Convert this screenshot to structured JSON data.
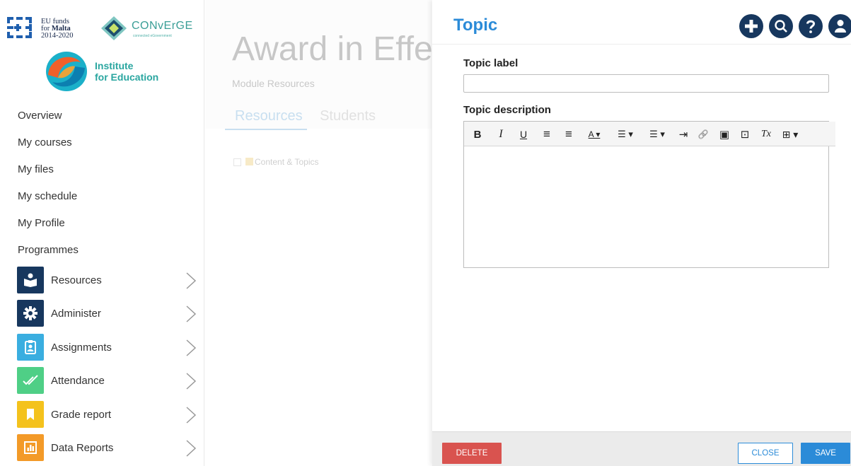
{
  "logos": {
    "eu_funds": {
      "line1": "EU funds",
      "line2_prefix": "for ",
      "line2_bold": "Malta",
      "line3": "2014-2020"
    },
    "converge": {
      "name": "CONvErGE",
      "tagline": "connected eGovernment"
    },
    "institute": {
      "line1": "Institute",
      "line2": "for Education"
    }
  },
  "sidebar": {
    "nav": [
      {
        "label": "Overview"
      },
      {
        "label": "My courses"
      },
      {
        "label": "My files"
      },
      {
        "label": "My schedule"
      },
      {
        "label": "My Profile"
      },
      {
        "label": "Programmes"
      }
    ],
    "menu": [
      {
        "label": "Resources",
        "icon": "resources-icon",
        "color": "#17375e"
      },
      {
        "label": "Administer",
        "icon": "gear-icon",
        "color": "#17375e"
      },
      {
        "label": "Assignments",
        "icon": "clipboard-icon",
        "color": "#3aaee0"
      },
      {
        "label": "Attendance",
        "icon": "checkmark-icon",
        "color": "#4fcf86"
      },
      {
        "label": "Grade report",
        "icon": "bookmark-icon",
        "color": "#f4c21d"
      },
      {
        "label": "Data Reports",
        "icon": "chart-icon",
        "color": "#f39a28"
      }
    ]
  },
  "main": {
    "title": "Award in Effec",
    "subtitle": "Module Resources",
    "tabs": [
      {
        "label": "Resources",
        "active": true
      },
      {
        "label": "Students",
        "active": false
      }
    ],
    "folder_label": "Content & Topics"
  },
  "panel": {
    "title": "Topic",
    "top_icons": [
      "add-icon",
      "search-icon",
      "help-icon",
      "user-icon"
    ],
    "label_field": {
      "label": "Topic label",
      "value": ""
    },
    "description_field": {
      "label": "Topic description",
      "value": ""
    },
    "toolbar": [
      {
        "name": "bold",
        "glyph": "B"
      },
      {
        "name": "italic",
        "glyph": "I"
      },
      {
        "name": "underline",
        "glyph": "U"
      },
      {
        "name": "align-left",
        "glyph": "≡"
      },
      {
        "name": "align-center",
        "glyph": "≡"
      },
      {
        "name": "text-color",
        "glyph": "A ▾"
      },
      {
        "name": "bullet-list",
        "glyph": "☰ ▾"
      },
      {
        "name": "numbered-list",
        "glyph": "☰ ▾"
      },
      {
        "name": "indent",
        "glyph": "⇥"
      },
      {
        "name": "link",
        "glyph": "🔗"
      },
      {
        "name": "image",
        "glyph": "▣"
      },
      {
        "name": "media",
        "glyph": "⊡"
      },
      {
        "name": "clear-format",
        "glyph": "Tx"
      },
      {
        "name": "table",
        "glyph": "⊞ ▾"
      }
    ],
    "buttons": {
      "delete": "DELETE",
      "close": "CLOSE",
      "save": "SAVE"
    }
  }
}
